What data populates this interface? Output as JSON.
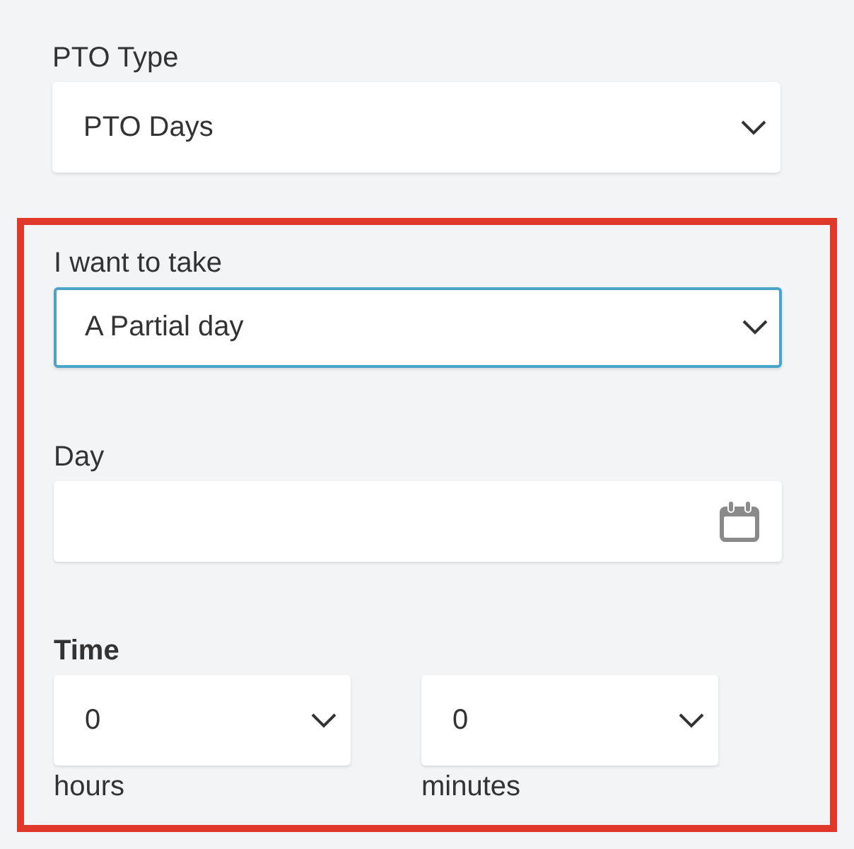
{
  "pto_type": {
    "label": "PTO Type",
    "value": "PTO Days",
    "focused": false
  },
  "highlighted_section": {
    "take": {
      "label": "I want to take",
      "value": "A Partial day",
      "focused": true
    },
    "day": {
      "label": "Day"
    },
    "time": {
      "label": "Time",
      "selects": [
        {
          "value": "0",
          "unit": "hours",
          "focused": false
        },
        {
          "value": "0",
          "unit": "minutes",
          "focused": false
        }
      ]
    }
  }
}
